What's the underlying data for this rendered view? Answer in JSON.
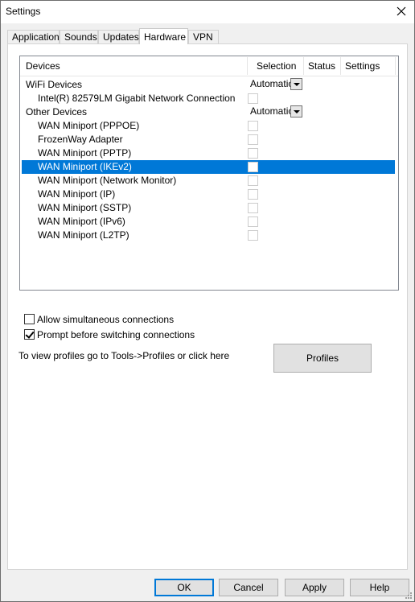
{
  "window": {
    "title": "Settings"
  },
  "tabs": [
    {
      "label": "Application"
    },
    {
      "label": "Sounds"
    },
    {
      "label": "Updates"
    },
    {
      "label": "Hardware"
    },
    {
      "label": "VPN"
    }
  ],
  "devices_list": {
    "columns": {
      "devices": "Devices",
      "selection": "Selection",
      "status": "Status",
      "settings": "Settings"
    },
    "groups": {
      "wifi": {
        "label": "WiFi Devices",
        "selection": "Automatic"
      },
      "other": {
        "label": "Other Devices",
        "selection": "Automatic"
      }
    },
    "items": [
      {
        "label": "Intel(R) 82579LM Gigabit Network Connection"
      },
      {
        "label": "WAN Miniport (PPPOE)"
      },
      {
        "label": "FrozenWay Adapter"
      },
      {
        "label": "WAN Miniport (PPTP)"
      },
      {
        "label": "WAN Miniport (IKEv2)"
      },
      {
        "label": "WAN Miniport (Network Monitor)"
      },
      {
        "label": "WAN Miniport (IP)"
      },
      {
        "label": "WAN Miniport (SSTP)"
      },
      {
        "label": "WAN Miniport (IPv6)"
      },
      {
        "label": "WAN Miniport (L2TP)"
      }
    ]
  },
  "options": {
    "allow_simultaneous": "Allow simultaneous connections",
    "prompt_before_switch": "Prompt before switching connections"
  },
  "profiles": {
    "hint": "To view profiles go to Tools->Profiles or click here",
    "button": "Profiles"
  },
  "buttons": {
    "ok": "OK",
    "cancel": "Cancel",
    "apply": "Apply",
    "help": "Help"
  },
  "colors": {
    "selection_highlight": "#0078d7",
    "default_button_border": "#0078d7"
  }
}
